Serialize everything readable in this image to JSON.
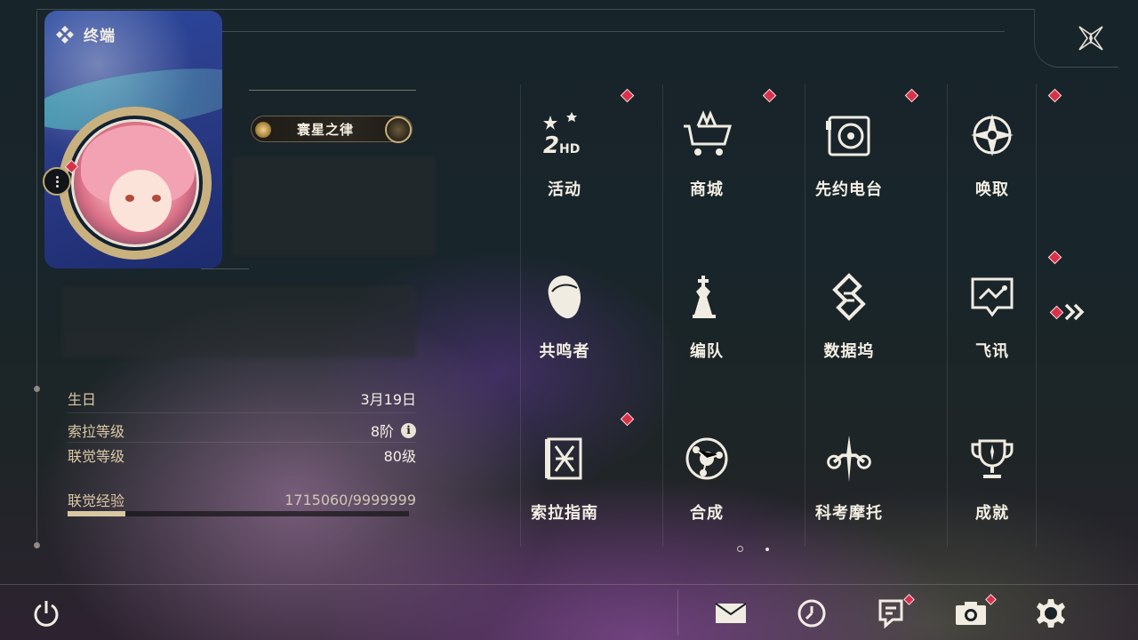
{
  "header": {
    "title": "终端"
  },
  "profile": {
    "name": "寰星之律",
    "stats": [
      {
        "label": "生日",
        "value": "3月19日"
      },
      {
        "label": "索拉等级",
        "value": "8阶"
      },
      {
        "label": "联觉等级",
        "value": "80级"
      }
    ],
    "exp": {
      "label": "联觉经验",
      "value": "1715060/9999999",
      "progress": 0.17
    }
  },
  "menu": [
    {
      "label": "活动",
      "icon": "event-2hd-icon",
      "badge": true
    },
    {
      "label": "商城",
      "icon": "shop-cart-icon",
      "badge": true
    },
    {
      "label": "先约电台",
      "icon": "radio-icon",
      "badge": true
    },
    {
      "label": "唤取",
      "icon": "summon-compass-icon",
      "badge": true
    },
    {
      "label": "共鸣者",
      "icon": "resonator-head-icon",
      "badge": false
    },
    {
      "label": "编队",
      "icon": "chess-team-icon",
      "badge": false
    },
    {
      "label": "数据坞",
      "icon": "data-dock-icon",
      "badge": false
    },
    {
      "label": "飞讯",
      "icon": "message-bubble-icon",
      "badge": true
    },
    {
      "label": "索拉指南",
      "icon": "guidebook-icon",
      "badge": true
    },
    {
      "label": "合成",
      "icon": "synthesis-icon",
      "badge": false
    },
    {
      "label": "科考摩托",
      "icon": "motorbike-icon",
      "badge": false
    },
    {
      "label": "成就",
      "icon": "trophy-icon",
      "badge": false
    }
  ],
  "pagination": {
    "pages": 2,
    "current": 1
  },
  "bottom_bar": {
    "left": [
      {
        "icon": "power-icon"
      }
    ],
    "right": [
      {
        "icon": "mail-icon",
        "badge": false
      },
      {
        "icon": "clock-icon",
        "badge": false
      },
      {
        "icon": "notice-icon",
        "badge": true
      },
      {
        "icon": "camera-icon",
        "badge": true
      },
      {
        "icon": "settings-gear-icon",
        "badge": false
      }
    ]
  },
  "colors": {
    "accent": "#d9c7a0",
    "badge": "#d8324a",
    "text": "#f4efe4",
    "label": "#dcc9a6"
  }
}
